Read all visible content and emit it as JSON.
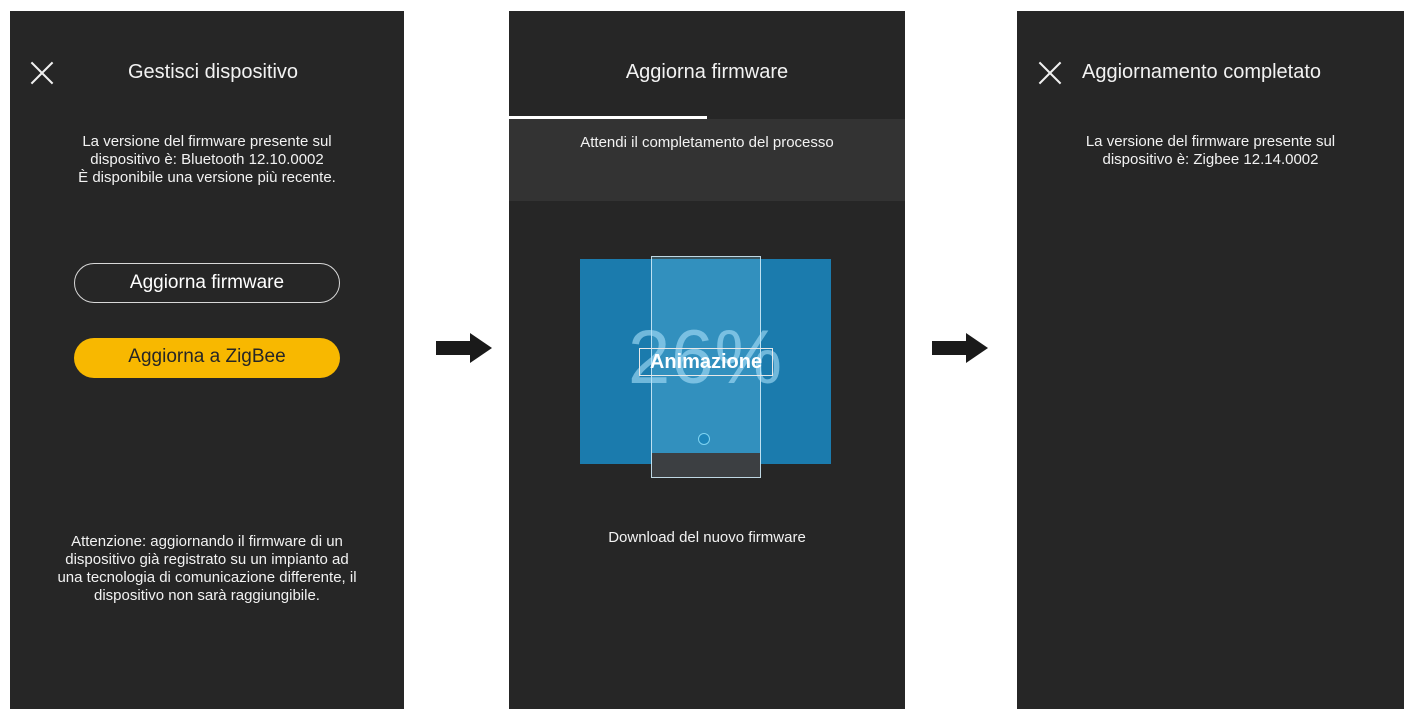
{
  "screen1": {
    "title": "Gestisci dispositivo",
    "info_lines": [
      "La versione del firmware presente sul",
      "dispositivo è: Bluetooth 12.10.0002",
      "È disponibile una versione più recente."
    ],
    "update_button": "Aggiorna firmware",
    "zigbee_button": "Aggiorna a ZigBee",
    "warning_lines": [
      "Attenzione: aggiornando il firmware di un",
      "dispositivo già registrato su un impianto ad",
      "una tecnologia di comunicazione differente, il",
      "dispositivo non sarà raggiungibile."
    ]
  },
  "screen2": {
    "title": "Aggiorna firmware",
    "progress_fraction": 0.5,
    "wait_message": "Attendi il completamento del processo",
    "percent": "26%",
    "animation_label": "Animazione",
    "download_message": "Download del nuovo firmware"
  },
  "screen3": {
    "title": "Aggiornamento completato",
    "info_lines": [
      "La versione del firmware presente sul",
      "dispositivo è: Zigbee 12.14.0002"
    ]
  },
  "icons": {
    "close": "close-icon",
    "arrow": "arrow-right-icon"
  },
  "colors": {
    "screen_bg": "#262626",
    "accent_yellow": "#f8b800",
    "animation_blue": "#1b7bad"
  }
}
